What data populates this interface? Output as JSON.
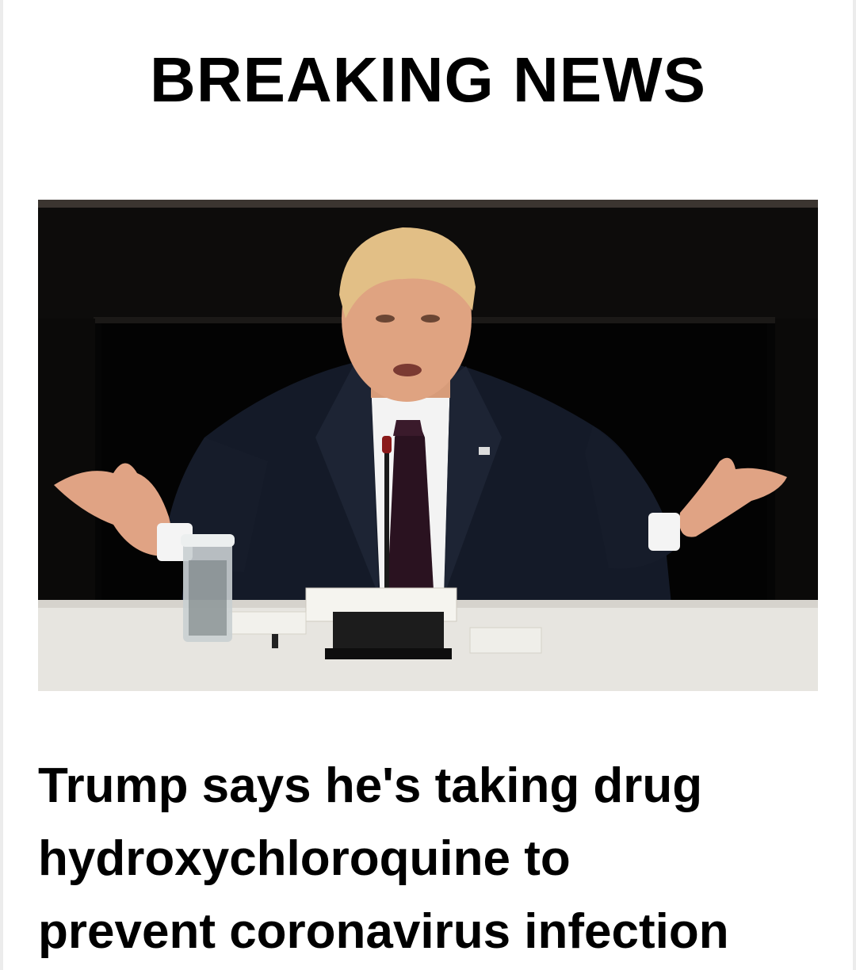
{
  "header": {
    "label": "BREAKING NEWS"
  },
  "photo": {
    "icon": "news-photo-image"
  },
  "article": {
    "title_lines": [
      "Trump says he's taking drug",
      "hydroxychloroquine to",
      "prevent coronavirus infection"
    ]
  }
}
